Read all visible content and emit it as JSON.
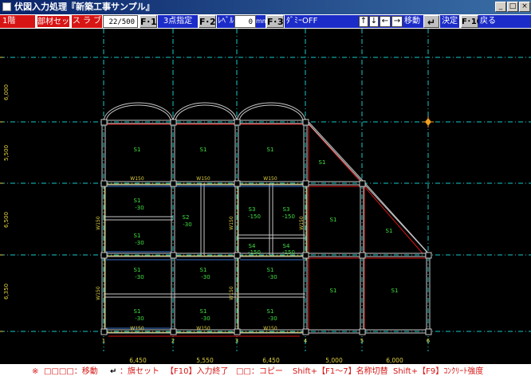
{
  "window": {
    "title": "伏図入力処理『新築工事サンプル』"
  },
  "toolbar": {
    "floor": "1階",
    "member_set": "部材セット",
    "member_type": "ス ラ ブ",
    "counter_value": "22/500",
    "f1": "F･1",
    "three_point": "3点指定",
    "f2": "F･2",
    "level_label": "ﾚﾍﾞﾙ",
    "level_value": "0",
    "level_unit": "mm",
    "f3": "F･3",
    "dummy": "ﾀﾞﾐｰOFF",
    "arrows": [
      "↑",
      "↓",
      "←",
      "→"
    ],
    "move": "移動",
    "enter_icon": "↵",
    "decide": "決定",
    "f10": "F･10",
    "back": "戻る"
  },
  "plan": {
    "row_dims": [
      "6,000",
      "5,500",
      "6,500",
      "6,350"
    ],
    "col_dims": [
      "6,450",
      "5,550",
      "6,450",
      "5,000",
      "6,000"
    ],
    "col_grid_labels": [
      "1",
      "2",
      "3",
      "4",
      "5",
      "6"
    ],
    "slab_label": "S1",
    "slab_minus": "-30",
    "s3_label": "S3",
    "s3_minus": "-150",
    "s4_label": "S4",
    "s2_label": "S2",
    "wall_label": "W150"
  },
  "status": {
    "mark": "※",
    "move_keys": "□□□□：移動",
    "move_label": "移動",
    "enter_icon": "↵",
    "flag_set": "：旗セット",
    "f10_end": "【F10】入力終了",
    "copy": "□□：コピー",
    "shift1": "Shift+【F1～7】名称切替",
    "shift2": "Shift+【F9】ｺﾝｸﾘｰﾄ強度"
  },
  "colors": {
    "grid": "#19c8c8",
    "beam": "#c8c8c8",
    "slab_outline": "#d81515",
    "text": "#40e040",
    "yellow": "#e0d040",
    "marker": "#f0a020",
    "blue_wall": "#4080e0"
  }
}
